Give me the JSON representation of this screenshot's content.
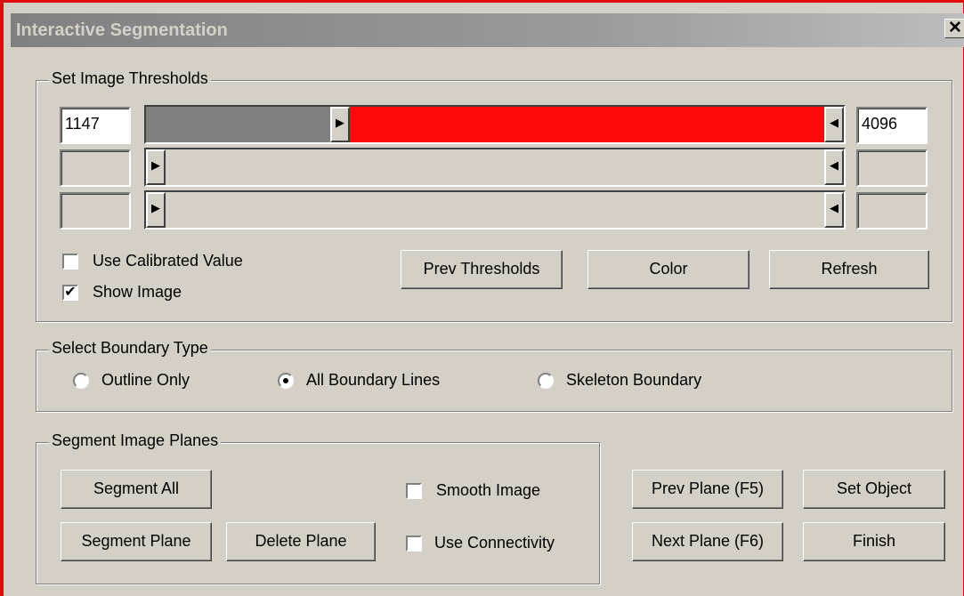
{
  "window": {
    "title": "Interactive Segmentation",
    "close_glyph": "✕",
    "accent_border_color": "#e20a0a"
  },
  "thresholds": {
    "group_label": "Set Image Thresholds",
    "rows": [
      {
        "min": "1147",
        "max": "4096",
        "enabled": true,
        "low_fraction": 0.28,
        "high_fraction": 1.0,
        "fill_color": "#ff0a0a"
      },
      {
        "min": "",
        "max": "",
        "enabled": false
      },
      {
        "min": "",
        "max": "",
        "enabled": false
      }
    ],
    "thumb_right_icon": "▶",
    "thumb_left_icon": "◀",
    "use_calibrated": {
      "label": "Use Calibrated Value",
      "checked": false
    },
    "show_image": {
      "label": "Show Image",
      "checked": true
    },
    "buttons": {
      "prev_thresholds": "Prev Thresholds",
      "color": "Color",
      "refresh": "Refresh"
    }
  },
  "boundary": {
    "group_label": "Select Boundary Type",
    "options": [
      {
        "label": "Outline Only",
        "selected": false
      },
      {
        "label": "All Boundary Lines",
        "selected": true
      },
      {
        "label": "Skeleton Boundary",
        "selected": false
      }
    ]
  },
  "planes": {
    "group_label": "Segment Image Planes",
    "segment_all": "Segment All",
    "segment_plane": "Segment Plane",
    "delete_plane": "Delete Plane",
    "smooth_image": {
      "label": "Smooth Image",
      "checked": false
    },
    "use_connectivity": {
      "label": "Use Connectivity",
      "checked": false
    }
  },
  "nav": {
    "prev_plane": "Prev Plane (F5)",
    "next_plane": "Next Plane (F6)",
    "set_object": "Set Object",
    "finish": "Finish"
  }
}
